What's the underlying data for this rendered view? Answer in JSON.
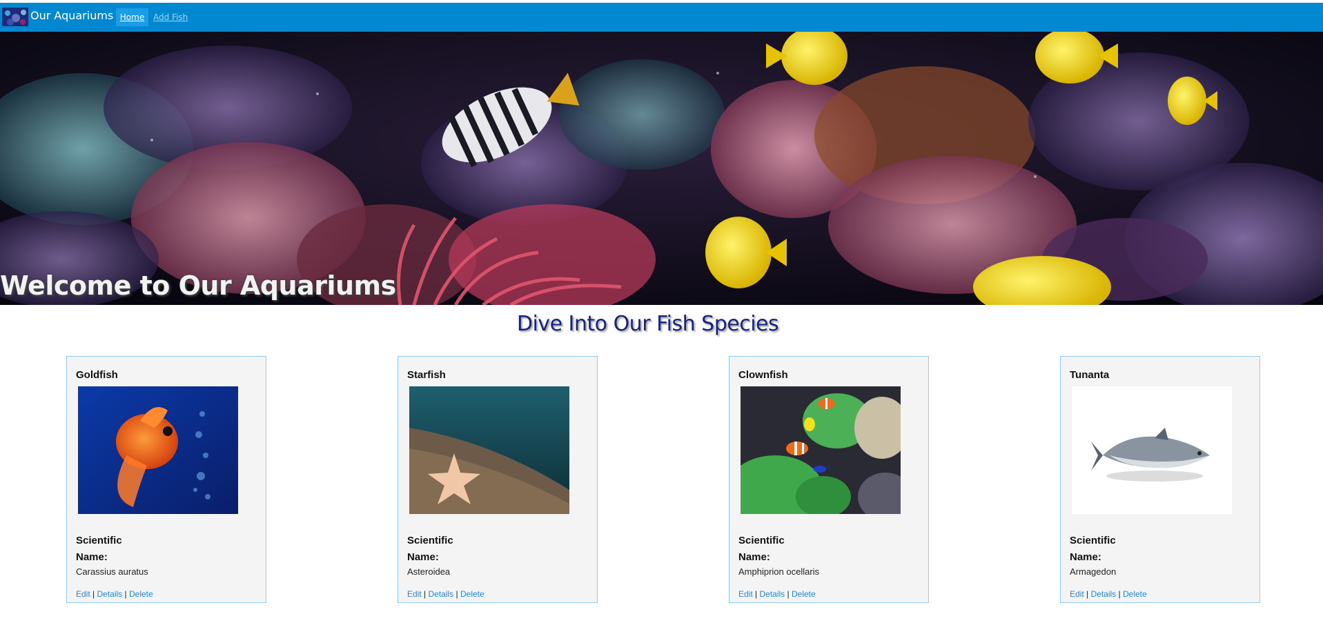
{
  "nav": {
    "brand": "Our Aquariums",
    "home": "Home",
    "add_fish": "Add Fish",
    "logo_icon": "aquarium-logo-icon"
  },
  "hero": {
    "title": "Welcome to Our Aquariums",
    "image": "coral-reef-banner"
  },
  "section": {
    "title": "Dive Into Our Fish Species"
  },
  "colors": {
    "navbar": "#0288d1",
    "card_border": "#90caf9",
    "link": "#1e88e5",
    "section_title": "#1a237e"
  },
  "cards": [
    {
      "name": "Goldfish",
      "sci_label": "Scientific Name:",
      "sci_name": "Carassius auratus",
      "edit": "Edit",
      "details": "Details",
      "delete": "Delete",
      "sep": "|"
    },
    {
      "name": "Starfish",
      "sci_label": "Scientific Name:",
      "sci_name": "Asteroidea",
      "edit": "Edit",
      "details": "Details",
      "delete": "Delete",
      "sep": "|"
    },
    {
      "name": "Clownfish",
      "sci_label": "Scientific Name:",
      "sci_name": "Amphiprion ocellaris",
      "edit": "Edit",
      "details": "Details",
      "delete": "Delete",
      "sep": "|"
    },
    {
      "name": "Tunanta",
      "sci_label": "Scientific Name:",
      "sci_name": "Armagedon",
      "edit": "Edit",
      "details": "Details",
      "delete": "Delete",
      "sep": "|"
    }
  ]
}
